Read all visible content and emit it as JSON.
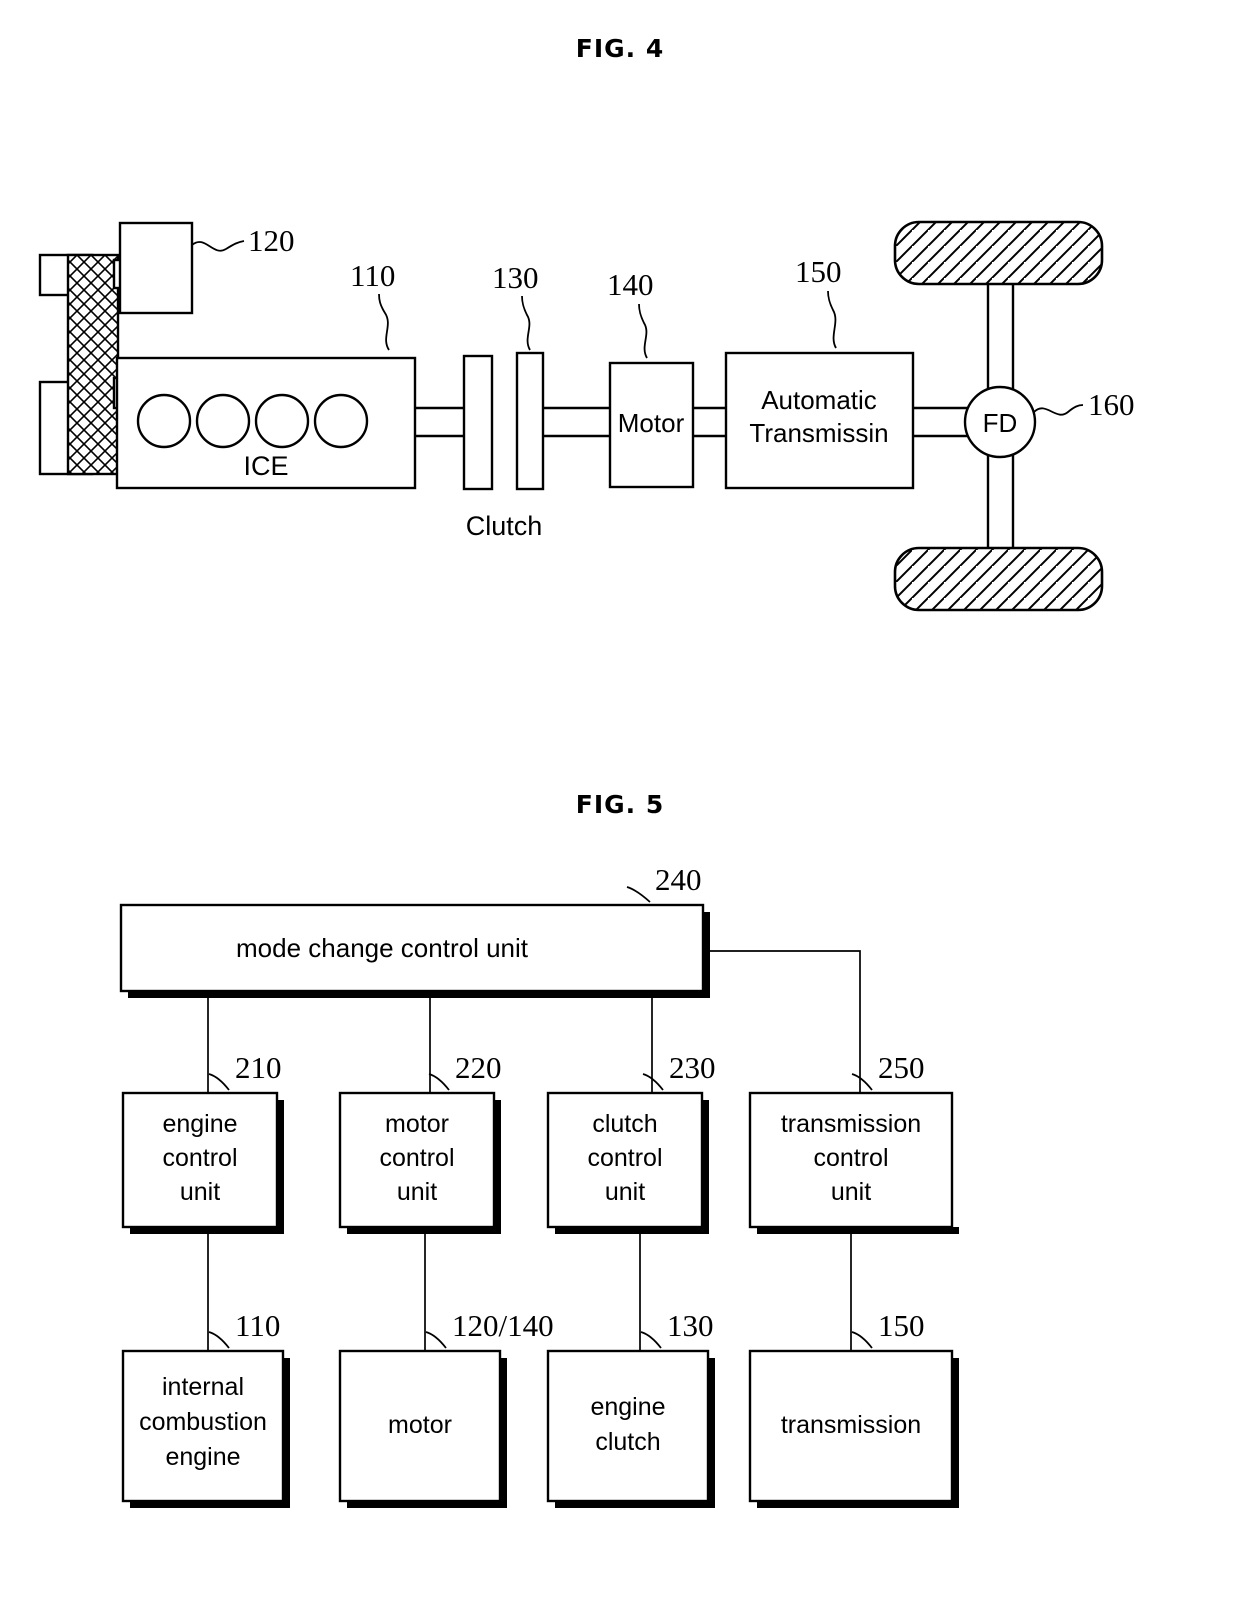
{
  "figures": [
    {
      "title": "FIG. 4",
      "id": "fig4",
      "caption_labels": {
        "battery_pack": "120",
        "engine": "110",
        "clutch_ref": "130",
        "motor_ref": "140",
        "transmission_ref": "150",
        "final_drive_ref": "160"
      },
      "blocks": {
        "ice": "ICE",
        "clutch": "Clutch",
        "motor": "Motor",
        "transmission_line1": "Automatic",
        "transmission_line2": "Transmissin",
        "final_drive": "FD"
      }
    },
    {
      "title": "FIG. 5",
      "id": "fig5",
      "top_unit": {
        "label": "mode change  control unit",
        "ref": "240"
      },
      "control_row": [
        {
          "ref": "210",
          "lines": [
            "engine",
            "control",
            "unit"
          ]
        },
        {
          "ref": "220",
          "lines": [
            "motor",
            "control",
            "unit"
          ]
        },
        {
          "ref": "230",
          "lines": [
            "clutch",
            "control",
            "unit"
          ]
        },
        {
          "ref": "250",
          "lines": [
            "transmission",
            "control",
            "unit"
          ]
        }
      ],
      "device_row": [
        {
          "ref": "110",
          "lines": [
            "internal",
            "combustion",
            "engine"
          ]
        },
        {
          "ref": "120/140",
          "lines": [
            "motor"
          ]
        },
        {
          "ref": "130",
          "lines": [
            "engine",
            "clutch"
          ]
        },
        {
          "ref": "150",
          "lines": [
            "transmission"
          ]
        }
      ]
    }
  ]
}
